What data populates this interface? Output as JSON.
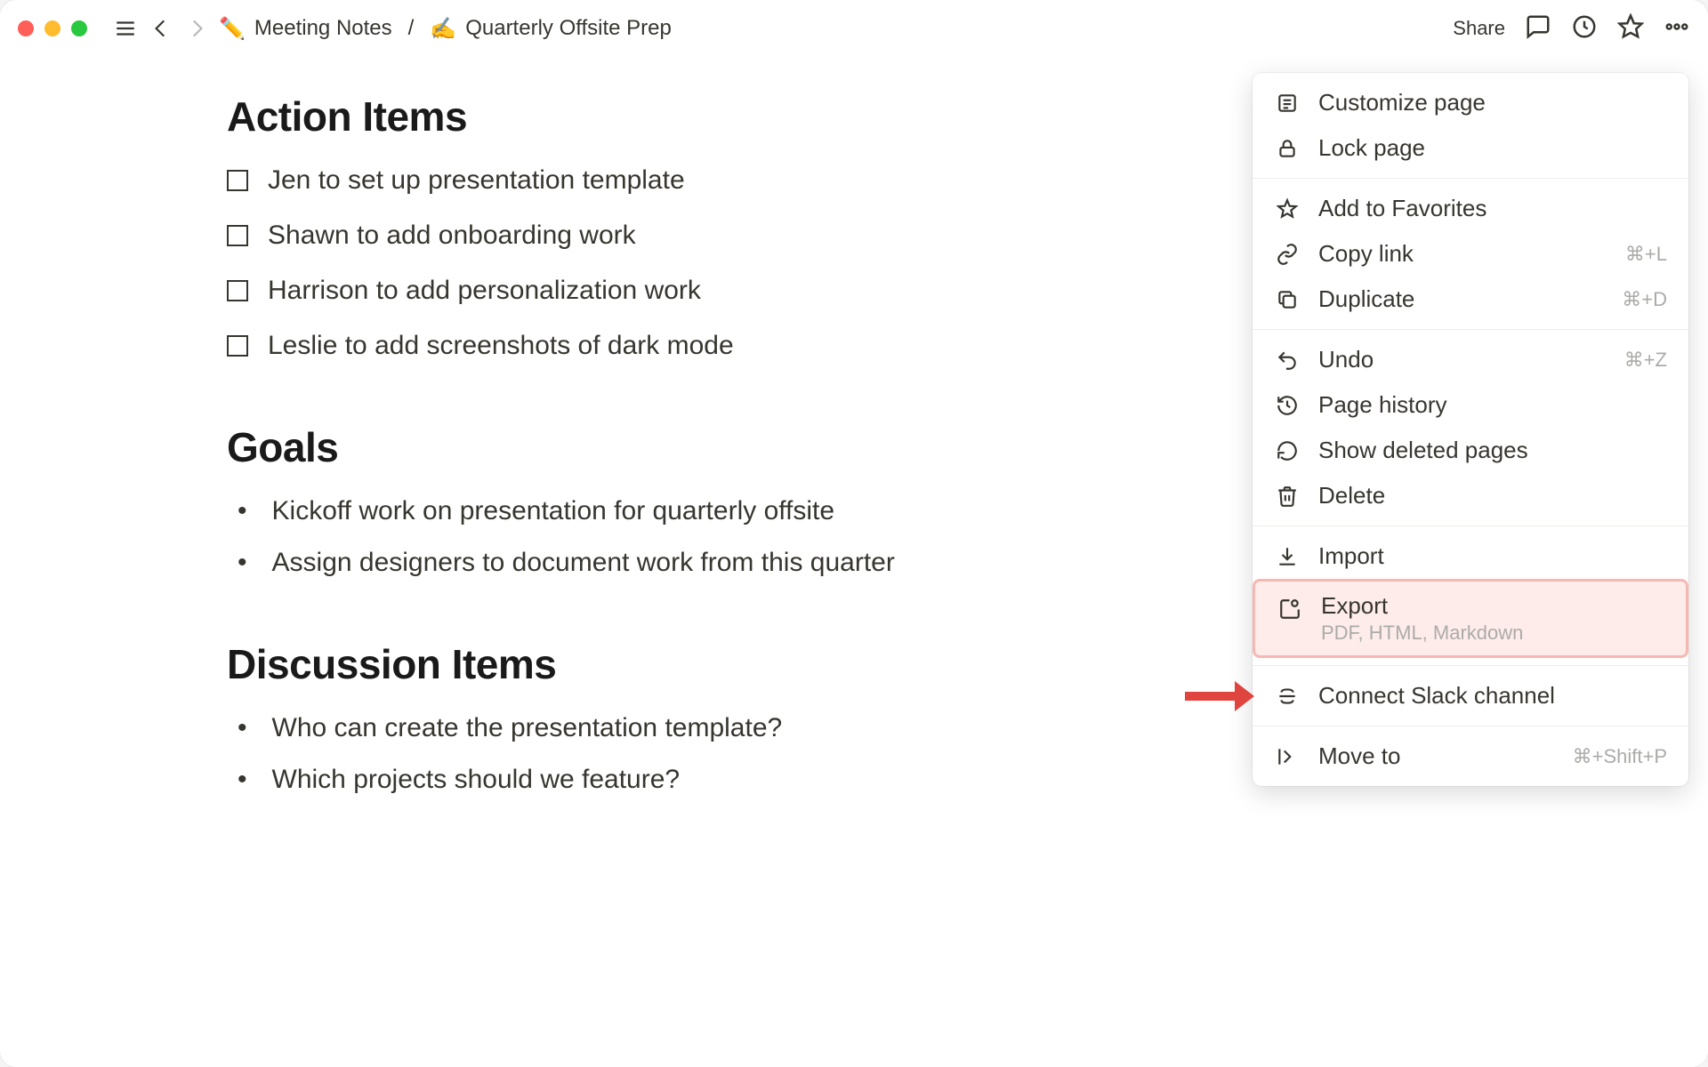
{
  "breadcrumb": {
    "parent_emoji": "✏️",
    "parent_label": "Meeting Notes",
    "sep": "/",
    "page_emoji": "✍️",
    "page_label": "Quarterly Offsite Prep"
  },
  "topbar": {
    "share_label": "Share"
  },
  "sections": {
    "action_items_heading": "Action Items",
    "action_items": [
      "Jen to set up presentation template",
      "Shawn to add onboarding work",
      "Harrison to add personalization work",
      "Leslie to add screenshots of dark mode"
    ],
    "goals_heading": "Goals",
    "goals": [
      "Kickoff work on presentation for quarterly offsite",
      "Assign designers to document work from this quarter"
    ],
    "discussion_heading": "Discussion Items",
    "discussion_items": [
      "Who can create the presentation template?",
      "Which projects should we feature?"
    ]
  },
  "menu": {
    "customize": "Customize page",
    "lock": "Lock page",
    "favorites": "Add to Favorites",
    "copy_link": "Copy link",
    "copy_link_sc": "⌘+L",
    "duplicate": "Duplicate",
    "duplicate_sc": "⌘+D",
    "undo": "Undo",
    "undo_sc": "⌘+Z",
    "history": "Page history",
    "deleted": "Show deleted pages",
    "delete": "Delete",
    "import": "Import",
    "export": "Export",
    "export_sub": "PDF, HTML, Markdown",
    "slack": "Connect Slack channel",
    "moveto": "Move to",
    "moveto_sc": "⌘+Shift+P"
  },
  "colors": {
    "highlight_bg": "#fdecea",
    "highlight_border": "#f6b8b2",
    "arrow": "#e0443e"
  }
}
